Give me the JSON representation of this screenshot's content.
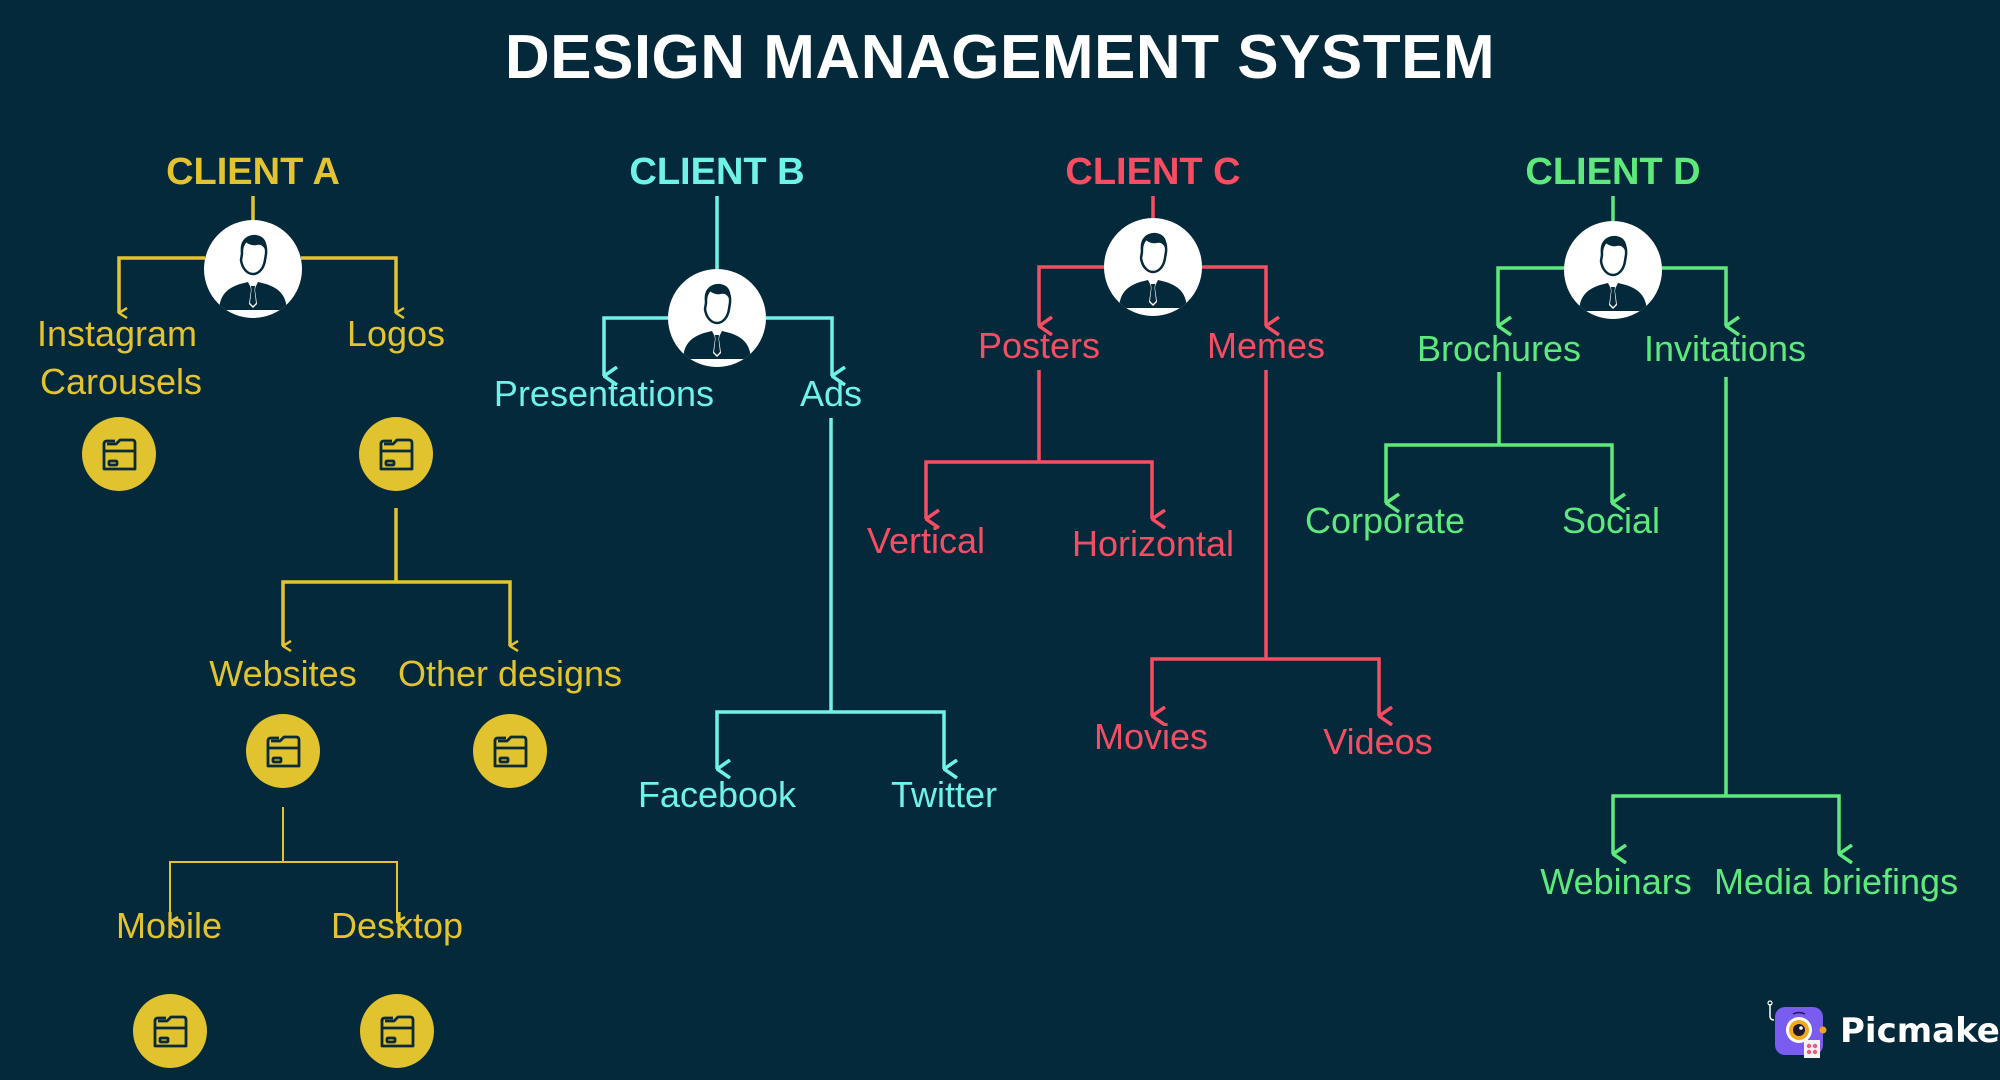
{
  "title": "DESIGN MANAGEMENT SYSTEM",
  "colors": {
    "background": "#04293a",
    "client_a": "#e3c42f",
    "client_b": "#6ef3e6",
    "client_c": "#f64d63",
    "client_d": "#5ee97d",
    "folder_fill": "#e0c32e"
  },
  "clients": {
    "a": {
      "name": "CLIENT A",
      "icon": "person-avatar-icon",
      "children": {
        "instagram": {
          "label_line1": "Instagram",
          "label_line2": "Carousels",
          "icon": "folder-icon"
        },
        "logos": {
          "label": "Logos",
          "icon": "folder-icon",
          "children": {
            "websites": {
              "label": "Websites",
              "icon": "folder-icon",
              "children": {
                "mobile": {
                  "label": "Mobile",
                  "icon": "folder-icon"
                },
                "desktop": {
                  "label": "Desktop",
                  "icon": "folder-icon"
                }
              }
            },
            "other": {
              "label": "Other designs",
              "icon": "folder-icon"
            }
          }
        }
      }
    },
    "b": {
      "name": "CLIENT B",
      "icon": "person-avatar-icon",
      "children": {
        "presentations": {
          "label": "Presentations"
        },
        "ads": {
          "label": "Ads",
          "children": {
            "facebook": {
              "label": "Facebook"
            },
            "twitter": {
              "label": "Twitter"
            }
          }
        }
      }
    },
    "c": {
      "name": "CLIENT C",
      "icon": "person-avatar-icon",
      "children": {
        "posters": {
          "label": "Posters",
          "children": {
            "vertical": {
              "label": "Vertical"
            },
            "horizontal": {
              "label": "Horizontal"
            }
          }
        },
        "memes": {
          "label": "Memes",
          "children": {
            "movies": {
              "label": "Movies"
            },
            "videos": {
              "label": "Videos"
            }
          }
        }
      }
    },
    "d": {
      "name": "CLIENT D",
      "icon": "person-avatar-icon",
      "children": {
        "brochures": {
          "label": "Brochures",
          "children": {
            "corporate": {
              "label": "Corporate"
            },
            "social": {
              "label": "Social"
            }
          }
        },
        "invitations": {
          "label": "Invitations",
          "children": {
            "webinars": {
              "label": "Webinars"
            },
            "media": {
              "label": "Media briefings"
            }
          }
        }
      }
    }
  },
  "branding": {
    "logo_icon": "picmaker-logo-icon",
    "name": "Picmaker"
  }
}
